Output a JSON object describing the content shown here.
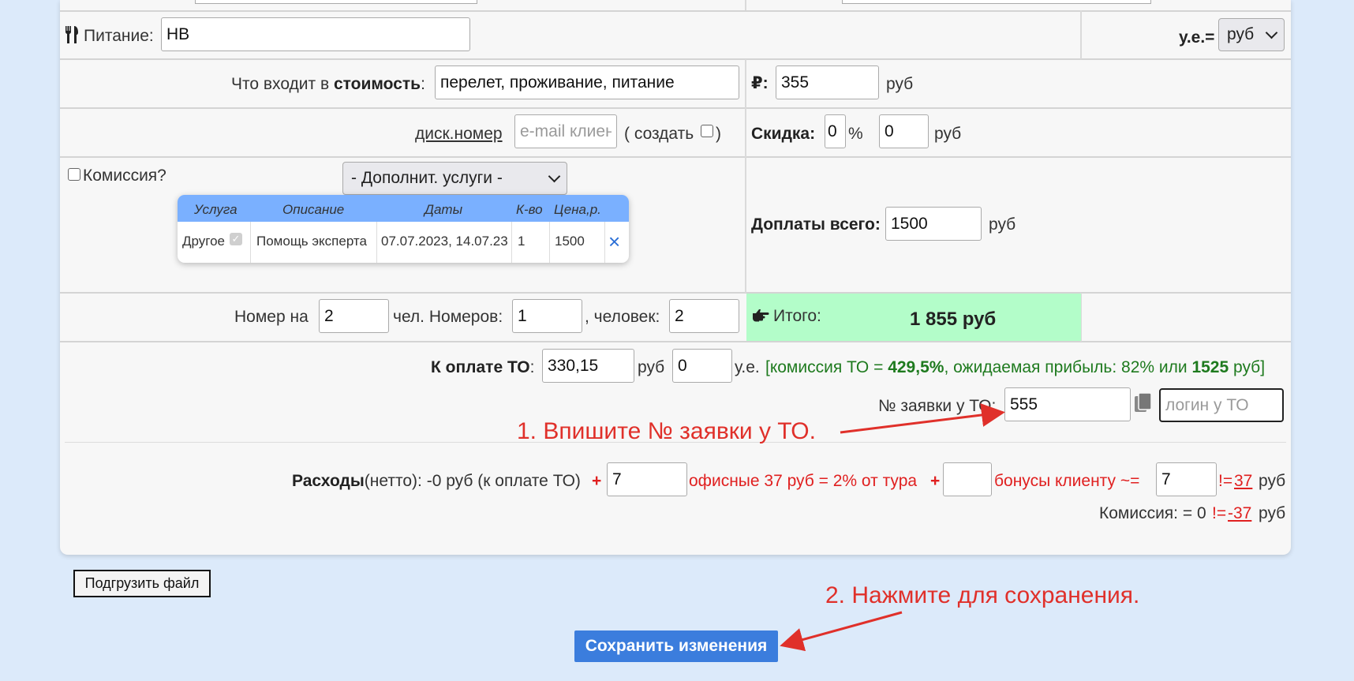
{
  "food": {
    "label": "Питание:",
    "value": "НВ",
    "icon": "fork-knife-icon"
  },
  "currency": {
    "label": "у.е.=",
    "selected": "руб"
  },
  "cost": {
    "label_prefix": "Что входит в ",
    "label_bold": "стоимость",
    "label_suffix": ":",
    "value": "перелет, проживание, питание"
  },
  "price": {
    "symbol": "₽:",
    "value": "355",
    "unit": "руб"
  },
  "discount_card": {
    "link": "диск.номер",
    "placeholder": "e-mail клиента",
    "create_open": "( создать",
    "create_close": ")"
  },
  "discount": {
    "label": "Скидка:",
    "percent": "0",
    "percent_unit": "%",
    "amount": "0",
    "unit": "руб"
  },
  "commission_checkbox": {
    "label": "Комиссия?"
  },
  "extra_services": {
    "select": "- Дополнит. услуги -",
    "headers": [
      "Услуга",
      "Описание",
      "Даты",
      "К-во",
      "Цена,р."
    ],
    "row": {
      "service": "Другое",
      "description": "Помощь эксперта",
      "dates": "07.07.2023, 14.07.23",
      "qty": "1",
      "price": "1500",
      "remove": "×"
    }
  },
  "surcharge": {
    "label": "Доплаты всего:",
    "value": "1500",
    "unit": "руб"
  },
  "room": {
    "label": "Номер на",
    "persons": "2",
    "label2": "чел. Номеров:",
    "rooms": "1",
    "label3": ", человек:",
    "people": "2"
  },
  "total": {
    "icon": "hand-pointing-icon",
    "label": "Итого:",
    "value": "1 855 руб"
  },
  "to_payment": {
    "label": "К оплате ТО",
    "colon": ":",
    "value": "330,15",
    "unit": "руб",
    "ue_value": "0",
    "ue_unit": "у.е.",
    "info_prefix": "[комиссия ТО = ",
    "info_pct": "429,5%",
    "info_mid": ", ожидаемая прибыль: 82% или ",
    "info_amount": "1525",
    "info_suffix": " руб]"
  },
  "booking": {
    "label": "№ заявки у ТО:",
    "value": "555",
    "login_placeholder": "логин у ТО",
    "copy_icon": "copy-icon"
  },
  "expenses": {
    "label_bold": "Расходы",
    "label": "(нетто): -0 руб (к оплате ТО)",
    "plus": "+",
    "office_value": "7",
    "office_text": "офисные 37 руб = 2% от тура",
    "bonus_value": "",
    "bonus_text": "бонусы клиенту ~=",
    "bonus_result": "7",
    "neq": "!=",
    "neq_value": "37",
    "unit": "руб"
  },
  "commission_line": {
    "label": "Комиссия: = 0",
    "neq": "!=",
    "value": "-37",
    "unit": "руб"
  },
  "buttons": {
    "upload": "Подгрузить файл",
    "save": "Сохранить изменения"
  },
  "notes": {
    "step1": "1. Впишите № заявки у ТО.",
    "step2": "2. Нажмите для сохранения."
  },
  "colors": {
    "total_bg": "#b3fdc9",
    "save_bg": "#3b7ddd",
    "note": "#e0302a",
    "green": "#1e7a1e"
  }
}
